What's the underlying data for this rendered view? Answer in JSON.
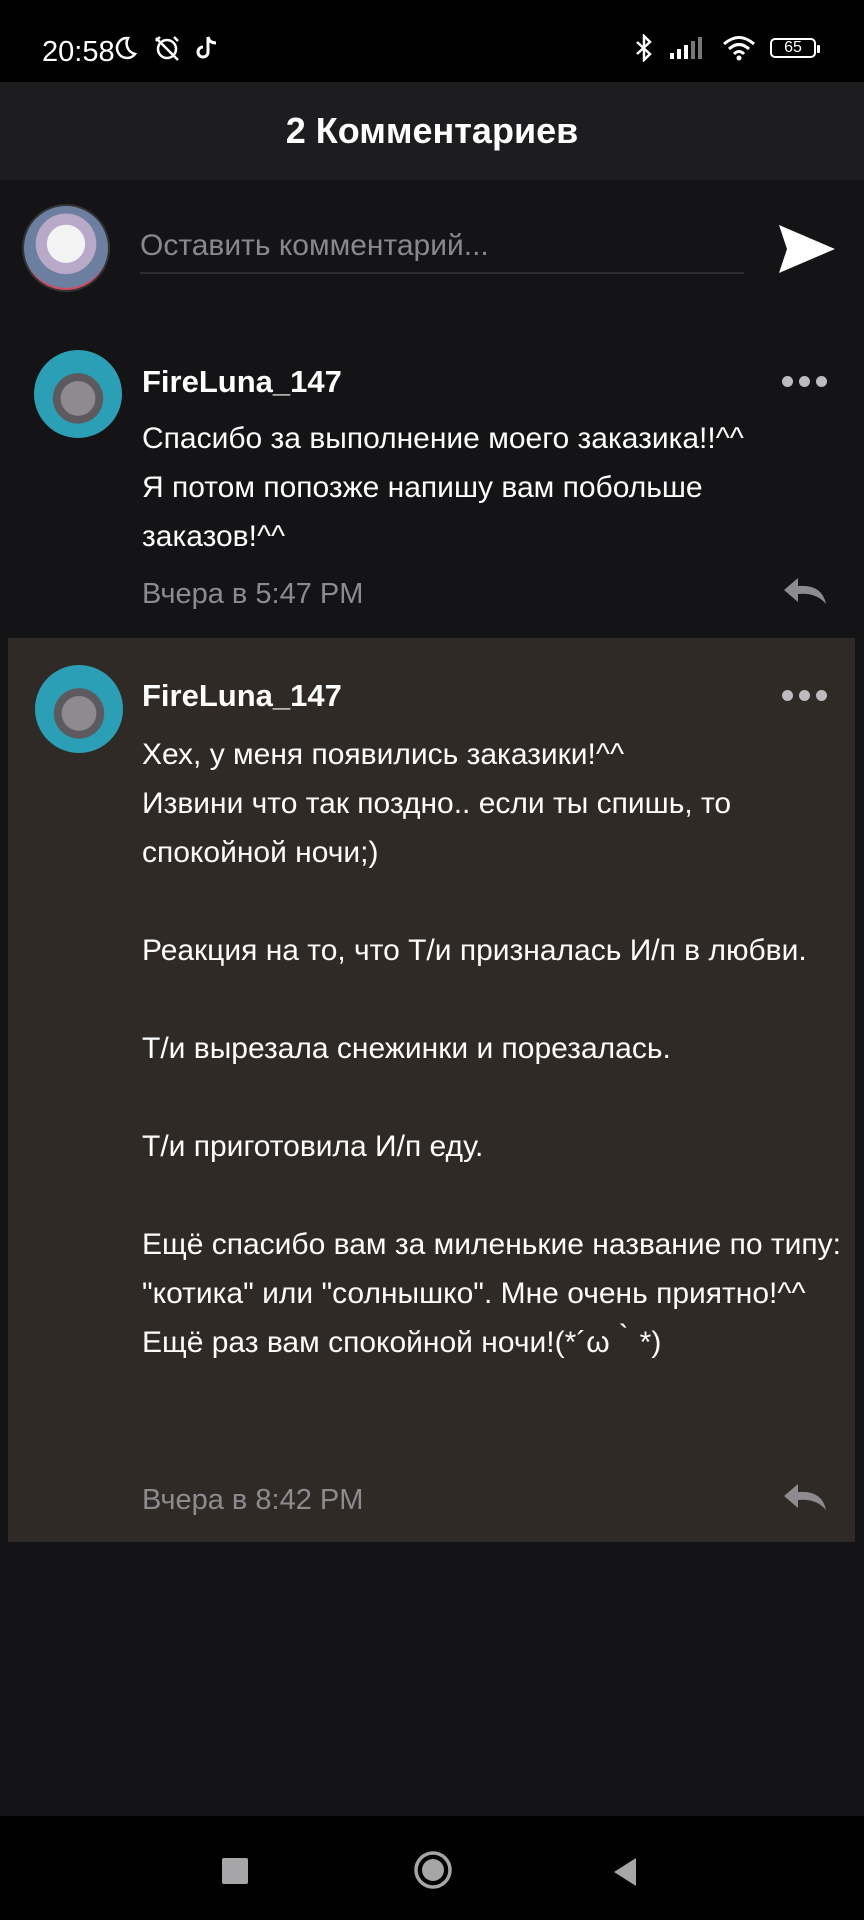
{
  "status_bar": {
    "time": "20:58",
    "battery": "65",
    "icons": [
      "moon-icon",
      "alarm-off-icon",
      "tiktok-icon",
      "bluetooth-icon",
      "signal-icon",
      "wifi-icon",
      "battery-icon"
    ]
  },
  "header": {
    "title": "2 Комментариев"
  },
  "compose": {
    "placeholder": "Оставить комментарий...",
    "send_icon": "send-icon"
  },
  "comments": [
    {
      "username": "FireLuna_147",
      "text": "Спасибо за выполнение моего заказика!!^^\nЯ потом попозже напишу вам побольше заказов!^^",
      "timestamp": "Вчера в 5:47 PM",
      "highlighted": false
    },
    {
      "username": "FireLuna_147",
      "text": "Хех, у меня появились заказики!^^\nИзвини что так поздно.. если ты спишь, то спокойной ночи;)\n\nРеакция на то, что Т/и призналась И/п в любви.\n\nТ/и вырезала снежинки и порезалась.\n\nТ/и приготовила И/п еду.\n\nЕщё спасибо вам за миленькие название по типу: \"котика\" или \"солнышко\". Мне очень приятно!^^\nЕщё раз вам спокойной ночи!(*´ω｀*)",
      "timestamp": "Вчера в 8:42 PM",
      "highlighted": true
    }
  ],
  "colors": {
    "background": "#141316",
    "header": "#1d1c1f",
    "highlight": "#302a27",
    "muted_text": "#8e8b90"
  }
}
